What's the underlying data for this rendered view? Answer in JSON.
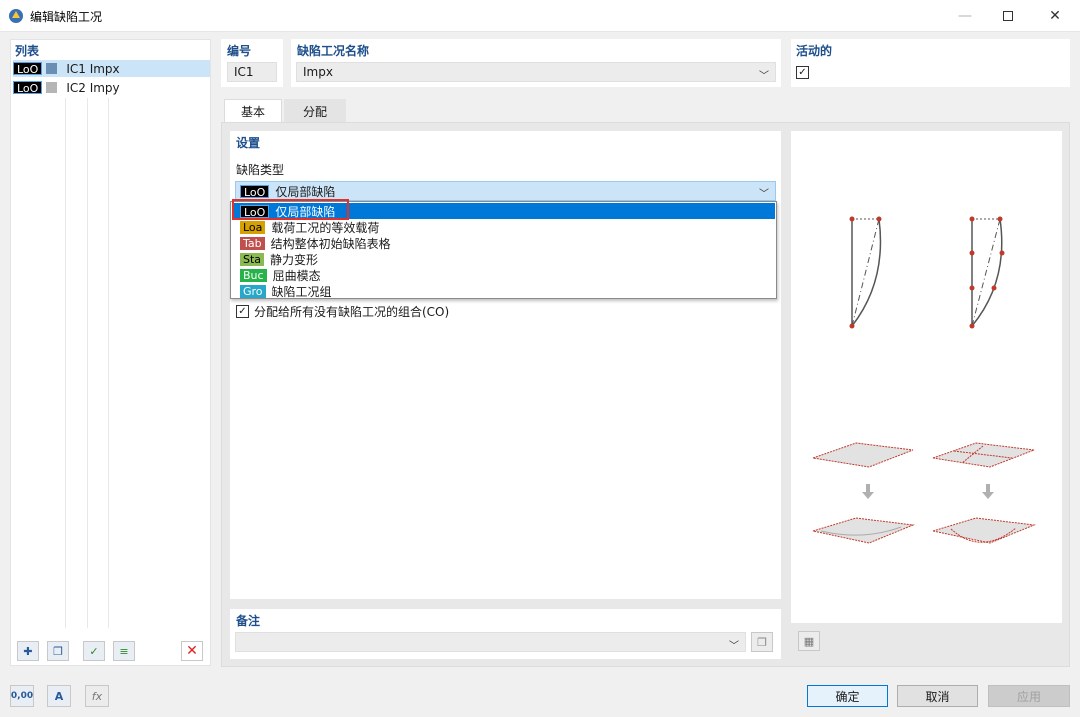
{
  "window": {
    "title": "编辑缺陷工况"
  },
  "list": {
    "header": "列表",
    "items": [
      {
        "tag": "LoO",
        "label": "IC1 Impx",
        "swatch_color": "#6a8fb5",
        "selected": true
      },
      {
        "tag": "LoO",
        "label": "IC2 Impy",
        "swatch_color": "#b5b5b5",
        "selected": false
      }
    ]
  },
  "header": {
    "number_label": "编号",
    "number_value": "IC1",
    "name_label": "缺陷工况名称",
    "name_value": "Impx",
    "active_label": "活动的",
    "active_checked": "✓"
  },
  "tabs": [
    {
      "label": "基本",
      "active": true
    },
    {
      "label": "分配",
      "active": false
    }
  ],
  "settings": {
    "header": "设置",
    "type_label": "缺陷类型",
    "type_selected_tag": "LoO",
    "type_selected_label": "仅局部缺陷",
    "options": [
      {
        "tag": "LoO",
        "label": "仅局部缺陷",
        "selected": true
      },
      {
        "tag": "Loa",
        "label": "载荷工况的等效载荷",
        "selected": false
      },
      {
        "tag": "Tab",
        "label": "结构整体初始缺陷表格",
        "selected": false
      },
      {
        "tag": "Sta",
        "label": "静力变形",
        "selected": false
      },
      {
        "tag": "Buc",
        "label": "屈曲模态",
        "selected": false
      },
      {
        "tag": "Gro",
        "label": "缺陷工况组",
        "selected": false
      }
    ],
    "assign_all_label": "分配给所有没有缺陷工况的组合(CO)",
    "assign_all_checked": "✓"
  },
  "comment": {
    "header": "备注",
    "value": ""
  },
  "footer": {
    "ok": "确定",
    "cancel": "取消",
    "apply": "应用",
    "units_icon_text": "0,00"
  },
  "colors": {
    "accent": "#0078d7",
    "header_text": "#1e4f8c",
    "highlight_box": "#e0312f",
    "delete_icon": "#e02020"
  }
}
